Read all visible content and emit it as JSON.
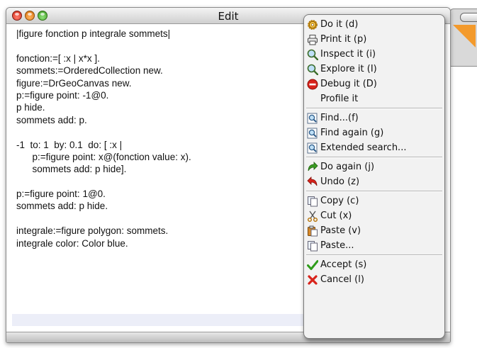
{
  "window": {
    "title": "Edit"
  },
  "editor": {
    "lines": [
      "|figure fonction p integrale sommets|",
      "",
      "fonction:=[ :x | x*x ].",
      "sommets:=OrderedCollection new.",
      "figure:=DrGeoCanvas new.",
      "p:=figure point: -1@0.",
      "p hide.",
      "sommets add: p.",
      "",
      "-1  to: 1  by: 0.1  do: [ :x |",
      "      p:=figure point: x@(fonction value: x).",
      "      sommets add: p hide].",
      "",
      "p:=figure point: 1@0.",
      "sommets add: p hide.",
      "",
      "integrale:=figure polygon: sommets.",
      "integrale color: Color blue."
    ]
  },
  "menu": {
    "items": [
      {
        "label": "Do it (d)",
        "icon": "gear-icon"
      },
      {
        "label": "Print it (p)",
        "icon": "printer-icon"
      },
      {
        "label": "Inspect it (i)",
        "icon": "magnifier-icon"
      },
      {
        "label": "Explore it (I)",
        "icon": "magnifier-icon"
      },
      {
        "label": "Debug it (D)",
        "icon": "stop-icon"
      },
      {
        "label": "Profile it",
        "icon": ""
      },
      {
        "label": "Find...(f)",
        "icon": "find-icon"
      },
      {
        "label": "Find again (g)",
        "icon": "find-again-icon"
      },
      {
        "label": "Extended search...",
        "icon": "extended-search-icon"
      },
      {
        "label": "Do again (j)",
        "icon": "redo-icon"
      },
      {
        "label": "Undo (z)",
        "icon": "undo-icon"
      },
      {
        "label": "Copy (c)",
        "icon": "copy-icon"
      },
      {
        "label": "Cut (x)",
        "icon": "scissors-icon"
      },
      {
        "label": "Paste (v)",
        "icon": "paste-icon"
      },
      {
        "label": "Paste...",
        "icon": "paste-icon"
      },
      {
        "label": "Accept (s)",
        "icon": "checkmark-icon"
      },
      {
        "label": "Cancel (l)",
        "icon": "cancel-x-icon"
      }
    ]
  },
  "colors": {
    "accept": "#2e9c1a",
    "cancel": "#d8231b",
    "debug": "#d8231b",
    "selection": "#eceef8"
  }
}
